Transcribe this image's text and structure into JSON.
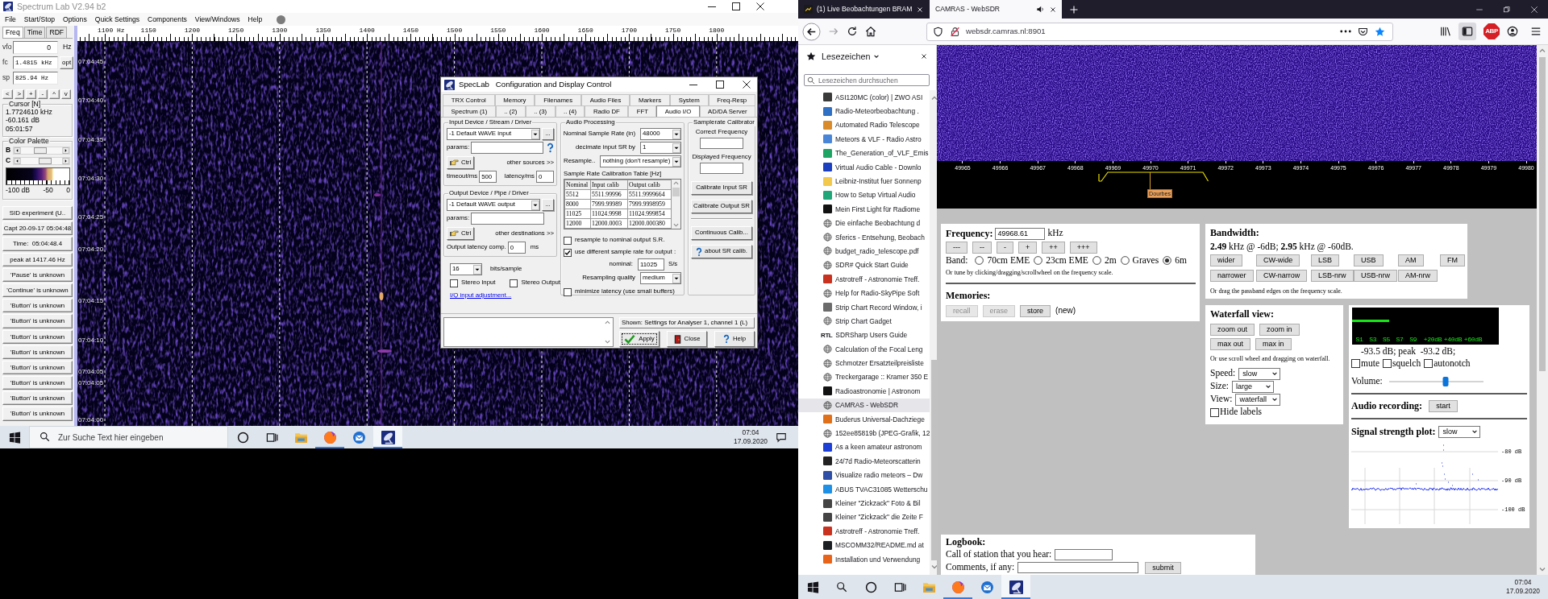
{
  "speclab": {
    "title": "Spectrum Lab V2.94 b2",
    "menu": [
      "File",
      "Start/Stop",
      "Options",
      "Quick Settings",
      "Components",
      "View/Windows",
      "Help"
    ],
    "side_tabs": [
      {
        "label": "Freq",
        "selected": true
      },
      {
        "label": "Time",
        "selected": false
      },
      {
        "label": "RDF",
        "selected": false
      }
    ],
    "fields": [
      {
        "label": "vfo",
        "value": "0",
        "unit": "Hz"
      },
      {
        "label": "fc",
        "value": "1.4815 kHz",
        "button": "opt"
      },
      {
        "label": "sp",
        "value": "825.94 Hz"
      }
    ],
    "step_buttons": [
      "<",
      ">",
      "+",
      "-",
      "^",
      "v"
    ],
    "cursor": {
      "title": "Cursor [N]",
      "lines": [
        "1.7724610 kHz",
        "-60.161 dB",
        "05:01:57"
      ]
    },
    "palette": {
      "title": "Color Palette",
      "sliders": [
        {
          "label": "B",
          "level": 0.48
        },
        {
          "label": "C",
          "level": 0.58
        }
      ],
      "scale": [
        "-100 dB",
        "-50",
        "0"
      ]
    },
    "buttons": [
      "SID experiment (U..",
      "Capt 20-09-17 05:04:48",
      "Time:  05:04:48.4",
      "peak at 1417.46 Hz",
      "'Pause' is unknown",
      "'Continue' is unknown",
      "'Button' is unknown",
      "'Button' is unknown",
      "'Button' is unknown",
      "'Button' is unknown",
      "'Button' is unknown",
      "'Button' is unknown",
      "'Button' is unknown",
      "'Button' is unknown"
    ],
    "freq_scale": [
      "1100 Hz",
      "1150",
      "1200",
      "1250",
      "1300",
      "1350",
      "1400",
      "1450",
      "1500",
      "1550",
      "1600",
      "1650",
      "1700",
      "1750",
      "1800"
    ],
    "time_labels": [
      "07:04:45",
      "07:04:40",
      "07:04:35",
      "07:04:30",
      "07:04:25",
      "07:04:20",
      "07:04:15",
      "07:04:10",
      "07:04:05",
      "07:04:05",
      "07:04:00"
    ]
  },
  "config_dialog": {
    "title": "SpecLab   Configuration and Display Control",
    "tab_rows": [
      [
        {
          "label": "TRX Control",
          "selected": false
        },
        {
          "label": "Memory",
          "selected": false
        },
        {
          "label": "Filenames",
          "selected": false
        },
        {
          "label": "Audio Files",
          "selected": false
        },
        {
          "label": "Markers",
          "selected": false
        },
        {
          "label": "System",
          "selected": false
        },
        {
          "label": "Freq-Resp",
          "selected": false
        }
      ],
      [
        {
          "label": "Spectrum (1)",
          "selected": false
        },
        {
          "label": ".. (2)",
          "selected": false
        },
        {
          "label": ".. (3)",
          "selected": false
        },
        {
          "label": ".. (4)",
          "selected": false
        },
        {
          "label": "Radio DF",
          "selected": false
        },
        {
          "label": "FFT",
          "selected": false
        },
        {
          "label": "Audio I/O",
          "selected": true
        },
        {
          "label": "AD/DA Server",
          "selected": false
        }
      ]
    ],
    "input_group": {
      "title": "Input Device / Stream / Driver",
      "device": "-1 Default WAVE input",
      "more": "...",
      "params_label": "params:",
      "help": true,
      "ctrl": "Ctrl",
      "other": "other sources >>",
      "latency_rows": [
        {
          "label": "timeout/ms",
          "value": "500"
        },
        {
          "label": "latency/ms",
          "value": "0"
        }
      ]
    },
    "output_group": {
      "title": "Output Device / Pipe / Driver",
      "device": "-1 Default WAVE output",
      "more": "...",
      "params_label": "params:",
      "help": false,
      "ctrl": "Ctrl",
      "other": "other destinations >>",
      "latency_rows": [
        {
          "label": "Output latency comp.",
          "value": "0",
          "unit": "ms"
        }
      ]
    },
    "bits": {
      "value": "16",
      "label": "bits/sample"
    },
    "stereo": [
      {
        "label": "Stereo Input",
        "checked": false
      },
      {
        "label": "Stereo Output",
        "checked": false
      }
    ],
    "iq_link": "I/Q input adjustment...",
    "processing": {
      "title": "Audio Processing",
      "selects": [
        {
          "label": "Nominal Sample Rate (in)",
          "value": "48000"
        },
        {
          "label": "decimate input SR by",
          "value": "1"
        },
        {
          "label": "Resample..",
          "value": "nothing (don't resample)"
        }
      ],
      "table_title": "Sample Rate Calibration Table [Hz]",
      "columns": [
        "Nominal",
        "Input calib",
        "Output calib"
      ],
      "table_rows": [
        [
          "5512",
          "5511.99996",
          "5511.9999664"
        ],
        [
          "8000",
          "7999.99989",
          "7999.9998959"
        ],
        [
          "11025",
          "11024.9998",
          "11024.999854"
        ],
        [
          "12000",
          "12000.0003",
          "12000.000380"
        ]
      ],
      "options": [
        {
          "label": "resample to nominal output S.R.",
          "checked": false
        },
        {
          "label": "use different sample rate for output :",
          "checked": true
        }
      ],
      "nominal_label": "nominal:",
      "nominal": "11025",
      "nominal_unit": "S/s",
      "quality_label": "Resampling quality",
      "quality": "medium",
      "minimize": {
        "label": "minimize latency (use small buffers)",
        "checked": false
      }
    },
    "calibrator": {
      "title": "Samplerate Calibrator",
      "fields": [
        "Correct Frequency",
        "Displayed Frequency"
      ],
      "buttons": [
        {
          "kind": "plain",
          "label": "Calibrate Input SR"
        },
        {
          "kind": "plain",
          "label": "Calibrate Output SR"
        },
        {
          "kind": "plain",
          "label": "Continuous Calib..."
        },
        {
          "kind": "help",
          "label": "about SR calib."
        }
      ]
    },
    "shown": "Shown: Settings for Analyser 1, channel 1 (L)",
    "actions": [
      {
        "kind": "apply",
        "label": "Apply"
      },
      {
        "kind": "close",
        "label": "Close"
      },
      {
        "kind": "help",
        "label": "Help"
      }
    ]
  },
  "taskbar_left": {
    "search_placeholder": "Zur Suche Text hier eingeben",
    "apps": [
      {
        "kind": "folder",
        "running": false,
        "active": false
      },
      {
        "kind": "browser",
        "running": true,
        "active": false
      },
      {
        "kind": "mail",
        "running": false,
        "active": false
      },
      {
        "kind": "dish",
        "running": true,
        "active": true
      }
    ],
    "time": "07:04",
    "date": "17.09.2020"
  },
  "browser": {
    "tabs": [
      {
        "title": "(1) Live Beobachtungen BRAM",
        "selected": false,
        "favicon": true,
        "audio": false
      },
      {
        "title": "CAMRAS - WebSDR",
        "selected": true,
        "favicon": false,
        "audio": true
      }
    ],
    "url": "websdr.camras.nl:8901",
    "sidebar_toggle_on": true,
    "adblock": "ABP",
    "sidebar": {
      "title": "Lesezeichen",
      "search_placeholder": "Lesezeichen durchsuchen",
      "bookmarks": [
        {
          "title": "ASI120MC (color) | ZWO ASI",
          "kind": "site",
          "color": "#3a3a3a",
          "selected": false
        },
        {
          "title": "Radio-Meteorbeobachtung .",
          "kind": "site",
          "color": "#2f6fc4",
          "selected": false
        },
        {
          "title": "Automated Radio Telescope",
          "kind": "site",
          "color": "#d98b2b",
          "selected": false
        },
        {
          "title": "Meteors & VLF - Radio Astro",
          "kind": "site",
          "color": "#4a86d8",
          "selected": false
        },
        {
          "title": "The_Generation_of_VLF_Emis",
          "kind": "site",
          "color": "#1fa463",
          "selected": false
        },
        {
          "title": "Virtual Audio Cable - Downlo",
          "kind": "site",
          "color": "#1c3fbf",
          "selected": false
        },
        {
          "title": "Leibniz-Institut fuer Sonnenp",
          "kind": "site",
          "color": "#f2c94c",
          "selected": false
        },
        {
          "title": "How to Setup Virtual Audio",
          "kind": "site",
          "color": "#21a67a",
          "selected": false
        },
        {
          "title": "Mein First Light für Radiome",
          "kind": "site",
          "color": "#111111",
          "selected": false
        },
        {
          "title": "Die einfache Beobachtung d",
          "kind": "globe",
          "selected": false
        },
        {
          "title": "Sferics - Entsehung, Beobach",
          "kind": "globe",
          "selected": false
        },
        {
          "title": "budget_radio_telescope.pdf",
          "kind": "globe",
          "selected": false
        },
        {
          "title": "SDR# Quick Start Guide",
          "kind": "globe",
          "selected": false
        },
        {
          "title": "Astrotreff - Astronomie Treff.",
          "kind": "site",
          "color": "#c8321e",
          "selected": false
        },
        {
          "title": "Help for Radio-SkyPipe Soft",
          "kind": "globe",
          "selected": false
        },
        {
          "title": "Strip Chart Record Window, i",
          "kind": "site",
          "color": "#6b6b6b",
          "selected": false
        },
        {
          "title": "Strip Chart Gadget",
          "kind": "globe",
          "selected": false
        },
        {
          "title": "SDRSharp Users Guide",
          "kind": "text",
          "logo_text": "RTL",
          "selected": false
        },
        {
          "title": "Calculation of the Focal Leng",
          "kind": "globe",
          "selected": false
        },
        {
          "title": "Schmotzer Ersatzteilpreisliste",
          "kind": "globe",
          "selected": false
        },
        {
          "title": "Treckergarage :: Kramer 350 E",
          "kind": "globe",
          "selected": false
        },
        {
          "title": "Radioastronomie | Astronom",
          "kind": "site",
          "color": "#111111",
          "selected": false
        },
        {
          "title": "CAMRAS - WebSDR",
          "kind": "globe",
          "selected": true
        },
        {
          "title": "Buderus Universal-Dachziege",
          "kind": "site",
          "color": "#e0701a",
          "selected": false
        },
        {
          "title": "152ee85819b (JPEG-Grafik, 12",
          "kind": "globe",
          "selected": false
        },
        {
          "title": "As a keen amateur astronom",
          "kind": "site",
          "color": "#1d3fd6",
          "selected": false
        },
        {
          "title": "24/7d Radio-Meteorscatterin",
          "kind": "site",
          "color": "#222222",
          "selected": false
        },
        {
          "title": "Visualize radio meteors – Dw",
          "kind": "site",
          "color": "#2f4fa6",
          "selected": false
        },
        {
          "title": "ABUS TVAC31085 Wetterschu",
          "kind": "site",
          "color": "#1e90e6",
          "selected": false
        },
        {
          "title": "Kleiner \"Zickzack\" Foto & Bil",
          "kind": "site",
          "color": "#444444",
          "selected": false
        },
        {
          "title": "Kleiner \"Zickzack\" die Zeite F",
          "kind": "site",
          "color": "#444444",
          "selected": false
        },
        {
          "title": "Astrotreff - Astronomie Treff.",
          "kind": "site",
          "color": "#c8321e",
          "selected": false
        },
        {
          "title": "MSCOMM32/README.md at",
          "kind": "site",
          "color": "#1b1f23",
          "selected": false
        },
        {
          "title": "Installation und Verwendung",
          "kind": "site",
          "color": "#e8641a",
          "selected": false
        }
      ]
    },
    "websdr": {
      "scale": [
        "49965",
        "49966",
        "49967",
        "49968",
        "49969",
        "49970",
        "49971",
        "49972",
        "49973",
        "49974",
        "49975",
        "49976",
        "49977",
        "49978",
        "49979",
        "49980"
      ],
      "marker": "Dourbes",
      "frequency": {
        "label": "Frequency:",
        "value": "49968.61",
        "unit": "kHz",
        "steps": [
          "---",
          "--",
          "-",
          "+",
          "++",
          "+++"
        ],
        "band_label": "Band:",
        "bands": [
          {
            "label": "70cm EME",
            "selected": false
          },
          {
            "label": "23cm EME",
            "selected": false
          },
          {
            "label": "2m",
            "selected": false
          },
          {
            "label": "Graves",
            "selected": false
          },
          {
            "label": "6m",
            "selected": true
          }
        ],
        "hint": "Or tune by clicking/dragging/scrollwheel on the frequency scale.",
        "memories_label": "Memories:",
        "memory_buttons": [
          {
            "label": "recall",
            "disabled": true
          },
          {
            "label": "erase",
            "disabled": true
          },
          {
            "label": "store",
            "disabled": false
          }
        ],
        "memory_note": "(new)"
      },
      "bandwidth": {
        "label": "Bandwidth:",
        "value": "**2.49** kHz @ -6dB; **2.95** kHz @ -60dB.",
        "rows": [
          [
            "wider",
            "CW-wide",
            "LSB",
            "USB",
            "AM",
            "FM"
          ],
          [
            "narrower",
            "CW-narrow",
            "LSB-nrw",
            "USB-nrw",
            "AM-nrw"
          ]
        ],
        "hint": "Or drag the passband edges on the frequency scale."
      },
      "waterfall": {
        "label": "Waterfall view:",
        "rows": [
          [
            "zoom out",
            "zoom in"
          ],
          [
            "max out",
            "max in"
          ]
        ],
        "hint": "Or use scroll wheel and dragging on waterfall.",
        "selects": [
          {
            "label": "Speed:",
            "value": "slow"
          },
          {
            "label": "Size:",
            "value": "large"
          },
          {
            "label": "View:",
            "value": "waterfall"
          }
        ],
        "hide_labels": {
          "label": "Hide labels",
          "checked": false
        }
      },
      "audio": {
        "smeter": {
          "level": 0.25,
          "scale": [
            "S1",
            "S3",
            "S5",
            "S7",
            "S9",
            "+20dB",
            "+40dB",
            "+60dB"
          ]
        },
        "reading": "-93.5 dB; peak  -93.2 dB;",
        "options": [
          {
            "label": "mute",
            "checked": false
          },
          {
            "label": "squelch",
            "checked": false
          },
          {
            "label": "autonotch",
            "checked": false
          }
        ],
        "volume": {
          "label": "Volume:",
          "level": 0.6
        },
        "recording": {
          "label": "Audio recording:",
          "button": "start"
        },
        "plot": {
          "label": "Signal strength plot:",
          "value": "slow",
          "y_labels": [
            "-80 dB",
            "-90 dB",
            "-100 dB"
          ]
        }
      },
      "logbook": {
        "label": "Logbook:",
        "fields": [
          "Call of station that you hear:",
          "Comments, if any:"
        ],
        "button": "submit"
      }
    }
  },
  "taskbar_right": {
    "apps": [
      {
        "kind": "folder",
        "running": false,
        "active": false
      },
      {
        "kind": "browser",
        "running": true,
        "active": false
      },
      {
        "kind": "mail",
        "running": false,
        "active": false
      },
      {
        "kind": "dish",
        "running": true,
        "active": true
      }
    ],
    "time": "07:04",
    "date": "17.09.2020"
  }
}
